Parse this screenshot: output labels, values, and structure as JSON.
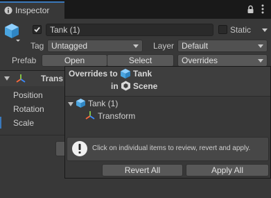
{
  "tab": {
    "title": "Inspector"
  },
  "window_icons": [
    "lock-icon",
    "kebab-menu-icon"
  ],
  "object": {
    "active_checked": true,
    "name": "Tank (1)",
    "static_label": "Static",
    "static_checked": false
  },
  "tag": {
    "label": "Tag",
    "value": "Untagged"
  },
  "layer": {
    "label": "Layer",
    "value": "Default"
  },
  "prefab": {
    "label": "Prefab",
    "open_label": "Open",
    "select_label": "Select",
    "overrides_label": "Overrides"
  },
  "transform": {
    "header_partial": "Trans",
    "rows": [
      "Position",
      "Rotation",
      "Scale"
    ]
  },
  "overrides_popup": {
    "line1_prefix": "Overrides to",
    "line1_name": "Tank",
    "line2_prefix": "in",
    "line2_suffix": "Scene",
    "tree_root": "Tank (1)",
    "tree_child": "Transform",
    "info_text": "Click on individual items to review, revert and apply.",
    "revert_all_label": "Revert All",
    "apply_all_label": "Apply All"
  },
  "colors": {
    "accent_blue": "#3a79bb",
    "prefab_cube": "#5aafe6",
    "panel_bg": "#383838"
  }
}
